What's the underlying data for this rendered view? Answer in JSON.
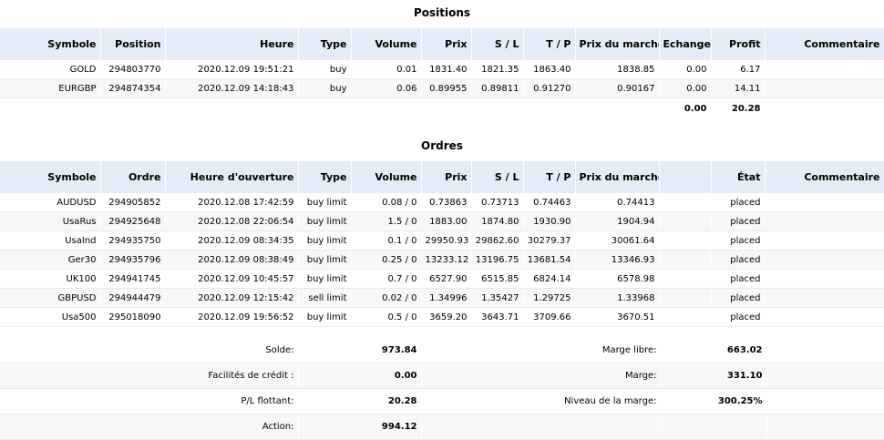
{
  "positions": {
    "title": "Positions",
    "columns": [
      "Symbole",
      "Position",
      "Heure",
      "Type",
      "Volume",
      "Prix",
      "S / L",
      "T / P",
      "Prix du marché",
      "Echange",
      "Profit",
      "Commentaire"
    ],
    "rows": [
      [
        "GOLD",
        "294803770",
        "2020.12.09 19:51:21",
        "buy",
        "0.01",
        "1831.40",
        "1821.35",
        "1863.40",
        "1838.85",
        "0.00",
        "6.17",
        ""
      ],
      [
        "EURGBP",
        "294874354",
        "2020.12.09 14:18:43",
        "buy",
        "0.06",
        "0.89955",
        "0.89811",
        "0.91270",
        "0.90167",
        "0.00",
        "14.11",
        ""
      ]
    ],
    "totals": {
      "echange": "0.00",
      "profit": "20.28"
    }
  },
  "orders": {
    "title": "Ordres",
    "columns": [
      "Symbole",
      "Ordre",
      "Heure d'ouverture",
      "Type",
      "Volume",
      "Prix",
      "S / L",
      "T / P",
      "Prix du marché",
      "",
      "État",
      "Commentaire"
    ],
    "rows": [
      [
        "AUDUSD",
        "294905852",
        "2020.12.08 17:42:59",
        "buy limit",
        "0.08 / 0",
        "0.73863",
        "0.73713",
        "0.74463",
        "0.74413",
        "",
        "placed",
        ""
      ],
      [
        "UsaRus",
        "294925648",
        "2020.12.08 22:06:54",
        "buy limit",
        "1.5 / 0",
        "1883.00",
        "1874.80",
        "1930.90",
        "1904.94",
        "",
        "placed",
        ""
      ],
      [
        "UsaInd",
        "294935750",
        "2020.12.09 08:34:35",
        "buy limit",
        "0.1 / 0",
        "29950.93",
        "29862.60",
        "30279.37",
        "30061.64",
        "",
        "placed",
        ""
      ],
      [
        "Ger30",
        "294935796",
        "2020.12.09 08:38:49",
        "buy limit",
        "0.25 / 0",
        "13233.12",
        "13196.75",
        "13681.54",
        "13346.93",
        "",
        "placed",
        ""
      ],
      [
        "UK100",
        "294941745",
        "2020.12.09 10:45:57",
        "buy limit",
        "0.7 / 0",
        "6527.90",
        "6515.85",
        "6824.14",
        "6578.98",
        "",
        "placed",
        ""
      ],
      [
        "GBPUSD",
        "294944479",
        "2020.12.09 12:15:42",
        "sell limit",
        "0.02 / 0",
        "1.34996",
        "1.35427",
        "1.29725",
        "1.33968",
        "",
        "placed",
        ""
      ],
      [
        "Usa500",
        "295018090",
        "2020.12.09 19:56:52",
        "buy limit",
        "0.5 / 0",
        "3659.20",
        "3643.71",
        "3709.66",
        "3670.51",
        "",
        "placed",
        ""
      ]
    ]
  },
  "summary": {
    "left": [
      {
        "label": "Solde:",
        "value": "973.84"
      },
      {
        "label": "Facilités de crédit :",
        "value": "0.00"
      },
      {
        "label": "P/L flottant:",
        "value": "20.28"
      },
      {
        "label": "Action:",
        "value": "994.12"
      }
    ],
    "right": [
      {
        "label": "Marge libre:",
        "value": "663.02"
      },
      {
        "label": "Marge:",
        "value": "331.10"
      },
      {
        "label": "Niveau de la marge:",
        "value": "300.25%"
      }
    ]
  }
}
